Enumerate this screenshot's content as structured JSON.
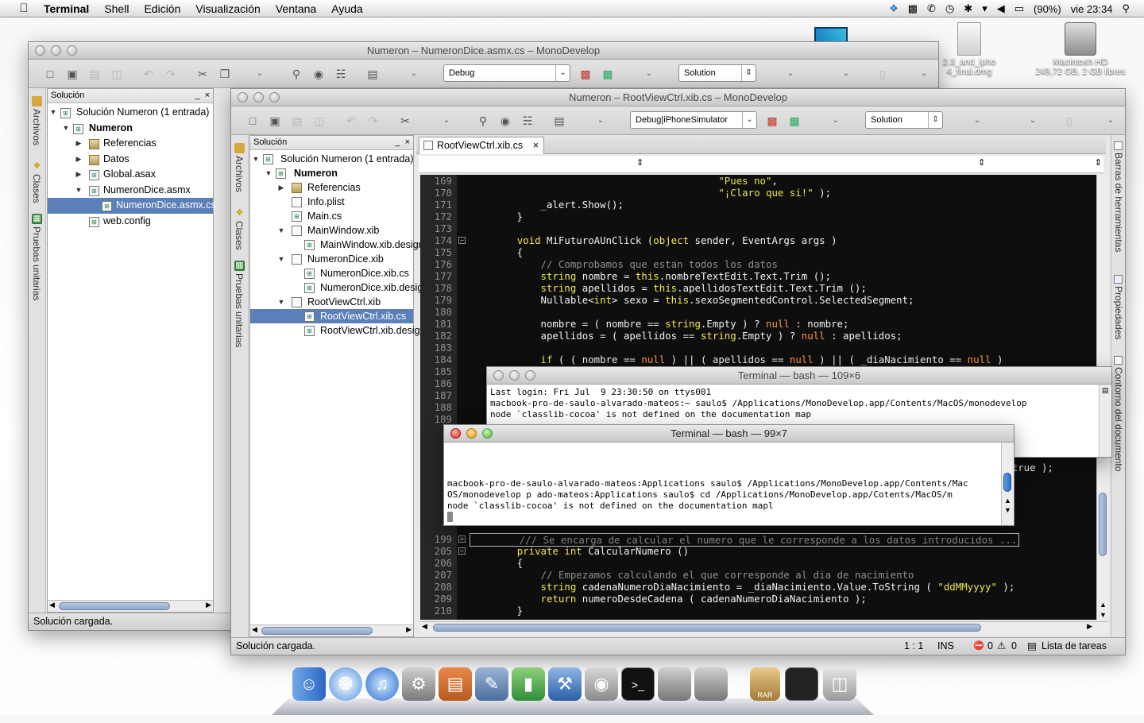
{
  "menubar": {
    "app": "Terminal",
    "items": [
      "Shell",
      "Edición",
      "Visualización",
      "Ventana",
      "Ayuda"
    ],
    "battery": "(90%)",
    "clock": "vie 23:34"
  },
  "desktop": {
    "dmg_label_1": "2.3_and_ipho",
    "dmg_label_2": "4_final.dmg",
    "hd_label": "Macintosh HD",
    "hd_size": "249,72 GB, 2 GB libres"
  },
  "win1": {
    "title": "Numeron – NumeronDice.asmx.cs – MonoDevelop",
    "config": "Debug",
    "solution_combo": "Solution",
    "pad_title": "Solución",
    "side_tabs": [
      "Archivos",
      "Clases",
      "Pruebas unitarias"
    ],
    "tree": [
      {
        "label": "Solución Numeron (1 entrada)",
        "bold": false
      },
      {
        "label": "Numeron",
        "bold": true
      },
      {
        "label": "Referencias",
        "bold": false
      },
      {
        "label": "Datos",
        "bold": false
      },
      {
        "label": "Global.asax",
        "bold": false
      },
      {
        "label": "NumeronDice.asmx",
        "bold": false
      },
      {
        "label": "NumeronDice.asmx.cs",
        "bold": false
      },
      {
        "label": "web.config",
        "bold": false
      }
    ],
    "status": "Solución cargada."
  },
  "win2": {
    "title": "Numeron – RootViewCtrl.xib.cs – MonoDevelop",
    "config": "Debug|iPhoneSimulator",
    "solution_combo": "Solution",
    "pad_title": "Solución",
    "side_tabs": [
      "Archivos",
      "Clases",
      "Pruebas unitarias"
    ],
    "right_tabs": [
      "Barras de herramientas",
      "Propiedades",
      "Contorno del documento"
    ],
    "tab": "RootViewCtrl.xib.cs",
    "tree": [
      {
        "label": "Solución Numeron (1 entrada)"
      },
      {
        "label": "Numeron"
      },
      {
        "label": "Referencias"
      },
      {
        "label": "Info.plist"
      },
      {
        "label": "Main.cs"
      },
      {
        "label": "MainWindow.xib"
      },
      {
        "label": "MainWindow.xib.designer.cs"
      },
      {
        "label": "NumeronDice.xib"
      },
      {
        "label": "NumeronDice.xib.cs"
      },
      {
        "label": "NumeronDice.xib.designer.cs"
      },
      {
        "label": "RootViewCtrl.xib"
      },
      {
        "label": "RootViewCtrl.xib.cs"
      },
      {
        "label": "RootViewCtrl.xib.designer.cs"
      }
    ],
    "status": "Solución cargada.",
    "cursor": "1 : 1",
    "mode": "INS",
    "errors": "0",
    "warnings": "0",
    "tasks": "Lista de tareas"
  },
  "code": {
    "lines": [
      {
        "n": "169",
        "t": "                                          \"Pues no\","
      },
      {
        "n": "170",
        "t": "                                          \"¡Claro que si!\" );"
      },
      {
        "n": "171",
        "t": "            _alert.Show();"
      },
      {
        "n": "172",
        "t": "        }"
      },
      {
        "n": "173",
        "t": ""
      },
      {
        "n": "174",
        "t": "        void MiFuturoAUnClick (object sender, EventArgs args )"
      },
      {
        "n": "175",
        "t": "        {"
      },
      {
        "n": "176",
        "t": "            // Comprobamos que estan todos los datos"
      },
      {
        "n": "177",
        "t": "            string nombre = this.nombreTextEdit.Text.Trim ();"
      },
      {
        "n": "178",
        "t": "            string apellidos = this.apellidosTextEdit.Text.Trim ();"
      },
      {
        "n": "179",
        "t": "            Nullable<int> sexo = this.sexoSegmentedControl.SelectedSegment;"
      },
      {
        "n": "180",
        "t": ""
      },
      {
        "n": "181",
        "t": "            nombre = ( nombre == string.Empty ) ? null : nombre;"
      },
      {
        "n": "182",
        "t": "            apellidos = ( apellidos == string.Empty ) ? null : apellidos;"
      },
      {
        "n": "183",
        "t": ""
      },
      {
        "n": "184",
        "t": "            if ( ( nombre == null ) || ( apellidos == null ) || ( _diaNacimiento == null )"
      },
      {
        "n": "185",
        "t": ""
      },
      {
        "n": "186",
        "t": ""
      },
      {
        "n": "187",
        "t": ""
      },
      {
        "n": "188",
        "t": ""
      },
      {
        "n": "189",
        "t": ""
      }
    ],
    "partial_line": "() ), true );",
    "lower_lines": [
      {
        "n": "199",
        "t": "        /// Se encarga de calcular el numero que le corresponde a los datos introducidos ..."
      },
      {
        "n": "205",
        "t": "        private int CalcularNumero ()"
      },
      {
        "n": "206",
        "t": "        {"
      },
      {
        "n": "207",
        "t": "            // Empezamos calculando el que corresponde al dia de nacimiento"
      },
      {
        "n": "208",
        "t": "            string cadenaNumeroDiaNacimiento = _diaNacimiento.Value.ToString ( \"ddMMyyyy\" );"
      },
      {
        "n": "209",
        "t": "            return numeroDesdeCadena ( cadenaNumeroDiaNacimiento );"
      },
      {
        "n": "210",
        "t": "        }"
      }
    ]
  },
  "term1": {
    "title": "Terminal — bash — 109×6",
    "lines": [
      "Last login: Fri Jul  9 23:30:50 on ttys001",
      "macbook-pro-de-saulo-alvarado-mateos:~ saulo$ /Applications/MonoDevelop.app/Contents/MacOS/monodevelop",
      "node `classlib-cocoa' is not defined on the documentation map"
    ]
  },
  "term2": {
    "title": "Terminal — bash — 99×7",
    "lines": [
      "",
      "",
      "",
      "macbook-pro-de-saulo-alvarado-mateos:Applications saulo$ /Applications/MonoDevelop.app/Contents/Mac",
      "OS/monodevelop p ado-mateos:Applications saulo$ cd /Applications/MonoDevelop.app/Cotents/MacOS/m",
      "node `classlib-cocoa' is not defined on the documentation mapl"
    ]
  },
  "dock": {
    "rar_label": "RAR"
  }
}
